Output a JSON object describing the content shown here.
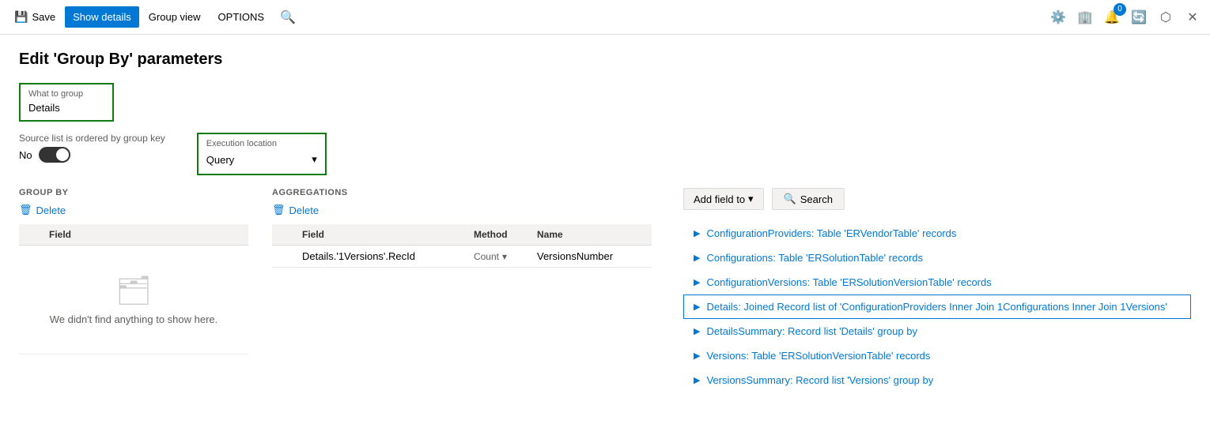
{
  "toolbar": {
    "save_label": "Save",
    "show_details_label": "Show details",
    "group_view_label": "Group view",
    "options_label": "OPTIONS"
  },
  "page": {
    "title": "Edit 'Group By' parameters"
  },
  "what_to_group": {
    "label": "What to group",
    "value": "Details"
  },
  "source_ordered": {
    "label": "Source list is ordered by group key",
    "toggle_label": "No"
  },
  "execution_location": {
    "label": "Execution location",
    "value": "Query"
  },
  "group_by_section": {
    "header": "GROUP BY",
    "delete_label": "Delete",
    "col_check": "",
    "col_field": "Field",
    "empty_text": "We didn't find anything to show here."
  },
  "aggregations_section": {
    "header": "AGGREGATIONS",
    "delete_label": "Delete",
    "col_check": "",
    "col_field": "Field",
    "col_method": "Method",
    "col_name": "Name",
    "rows": [
      {
        "field": "Details.'1Versions'.RecId",
        "method": "Count",
        "name": "VersionsNumber"
      }
    ]
  },
  "right_panel": {
    "add_field_label": "Add field to",
    "search_label": "Search",
    "tree_items": [
      {
        "text": "ConfigurationProviders: Table 'ERVendorTable' records",
        "highlighted": false
      },
      {
        "text": "Configurations: Table 'ERSolutionTable' records",
        "highlighted": false
      },
      {
        "text": "ConfigurationVersions: Table 'ERSolutionVersionTable' records",
        "highlighted": false
      },
      {
        "text": "Details: Joined Record list of 'ConfigurationProviders Inner Join 1Configurations Inner Join 1Versions'",
        "highlighted": true
      },
      {
        "text": "DetailsSummary: Record list 'Details' group by",
        "highlighted": false
      },
      {
        "text": "Versions: Table 'ERSolutionVersionTable' records",
        "highlighted": false
      },
      {
        "text": "VersionsSummary: Record list 'Versions' group by",
        "highlighted": false
      }
    ]
  }
}
